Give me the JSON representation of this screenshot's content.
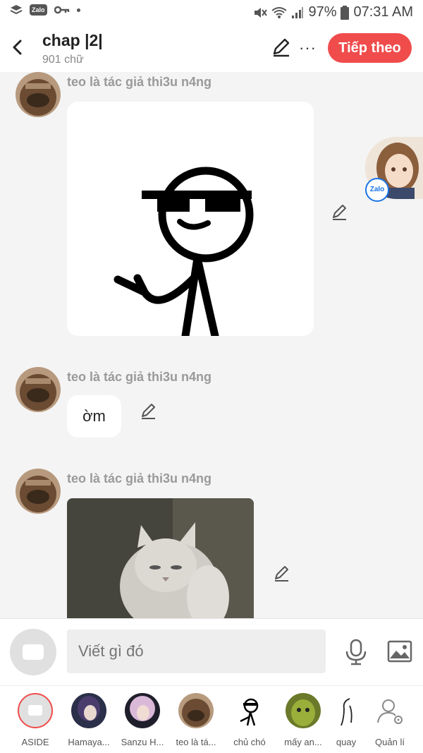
{
  "status_bar": {
    "zalo_label": "Zalo",
    "battery": "97%",
    "time": "07:31 AM"
  },
  "header": {
    "title": "chap |2|",
    "word_count": "901 chữ",
    "next_button": "Tiếp theo",
    "more": "···"
  },
  "messages": [
    {
      "author": "teo là tác giả thi3u n4ng",
      "type": "image",
      "image_icon": "sunglasses-stickman-meme"
    },
    {
      "author": "teo là tác giả thi3u n4ng",
      "type": "text",
      "text": "ờm"
    },
    {
      "author": "teo là tác giả thi3u n4ng",
      "type": "image",
      "image_icon": "white-cat-photo"
    }
  ],
  "floating": {
    "badge": "Zalo"
  },
  "composer": {
    "placeholder": "Viết gì đó"
  },
  "bottom_nav": [
    {
      "label": "ASIDE"
    },
    {
      "label": "Hamaya..."
    },
    {
      "label": "Sanzu H..."
    },
    {
      "label": "teo là tá..."
    },
    {
      "label": "chủ chó"
    },
    {
      "label": "mấy an..."
    },
    {
      "label": "quay"
    },
    {
      "label": "Quản lí"
    }
  ],
  "colors": {
    "accent": "#f04c4c",
    "background": "#f4f4f4",
    "author_text": "#9a9a9a"
  }
}
